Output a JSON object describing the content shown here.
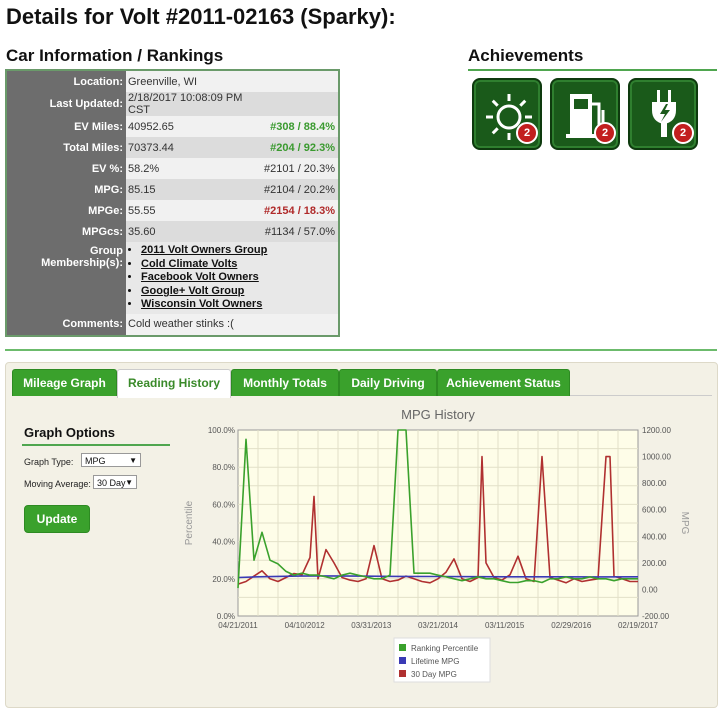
{
  "title": "Details for Volt #2011-02163 (Sparky):",
  "sections": {
    "car_info": "Car Information / Rankings",
    "achievements": "Achievements"
  },
  "info_rows": [
    {
      "label": "Location:",
      "value": "Greenville, WI",
      "rank": "",
      "rank_style": "norm"
    },
    {
      "label": "Last Updated:",
      "value": "2/18/2017 10:08:09 PM CST",
      "rank": "",
      "rank_style": "norm"
    },
    {
      "label": "EV Miles:",
      "value": "40952.65",
      "rank": "#308 / 88.4%",
      "rank_style": "good"
    },
    {
      "label": "Total Miles:",
      "value": "70373.44",
      "rank": "#204 / 92.3%",
      "rank_style": "good"
    },
    {
      "label": "EV %:",
      "value": "58.2%",
      "rank": "#2101 / 20.3%",
      "rank_style": "norm"
    },
    {
      "label": "MPG:",
      "value": "85.15",
      "rank": "#2104 / 20.2%",
      "rank_style": "norm"
    },
    {
      "label": "MPGe:",
      "value": "55.55",
      "rank": "#2154 / 18.3%",
      "rank_style": "bad"
    },
    {
      "label": "MPGcs:",
      "value": "35.60",
      "rank": "#1134 / 57.0%",
      "rank_style": "norm"
    }
  ],
  "groups_label": "Group Membership(s):",
  "groups": [
    "2011 Volt Owners Group",
    "Cold Climate Volts",
    "Facebook Volt Owners",
    "Google+ Volt Group",
    "Wisconsin Volt Owners"
  ],
  "comments_label": "Comments:",
  "comments": "Cold weather stinks :(",
  "achievements": [
    {
      "icon": "sun-icon",
      "count": "2"
    },
    {
      "icon": "gas-pump-icon",
      "count": "2"
    },
    {
      "icon": "electric-plug-icon",
      "count": "2"
    }
  ],
  "colors": {
    "accent": "#3aa12c",
    "ev_percentile": "#3aa12c",
    "lifetime_mpg": "#3a3ab5",
    "mpg_30day": "#b03030"
  },
  "tabs": [
    {
      "label": "Mileage Graph",
      "active": false
    },
    {
      "label": "Reading History",
      "active": true
    },
    {
      "label": "Monthly Totals",
      "active": false
    },
    {
      "label": "Daily Driving",
      "active": false
    },
    {
      "label": "Achievement Status",
      "active": false
    }
  ],
  "graph_options": {
    "title": "Graph Options",
    "type_label": "Graph Type:",
    "type_value": "MPG",
    "avg_label": "Moving Average:",
    "avg_value": "30 Day",
    "update_label": "Update"
  },
  "chart_data": {
    "type": "line",
    "title": "MPG History",
    "ylabel": "Percentile",
    "y2label": "MPG",
    "ylim": [
      0,
      100
    ],
    "y2lim": [
      -200,
      1200
    ],
    "x_ticks": [
      "04/21/2011",
      "04/10/2012",
      "03/31/2013",
      "03/21/2014",
      "03/11/2015",
      "02/29/2016",
      "02/19/2017"
    ],
    "y_ticks": [
      "0.0%",
      "20.0%",
      "40.0%",
      "60.0%",
      "80.0%",
      "100.0%"
    ],
    "y2_ticks": [
      "-200.00",
      "0.00",
      "200.00",
      "400.00",
      "600.00",
      "800.00",
      "1000.00",
      "1200.00"
    ],
    "legend": [
      "Ranking Percentile",
      "Lifetime MPG",
      "30 Day MPG"
    ],
    "legend_position": "bottom",
    "grid": true,
    "series": [
      {
        "name": "Ranking Percentile",
        "axis": "left",
        "x": [
          0,
          0.02,
          0.04,
          0.06,
          0.08,
          0.1,
          0.12,
          0.14,
          0.16,
          0.18,
          0.2,
          0.22,
          0.24,
          0.26,
          0.28,
          0.3,
          0.32,
          0.34,
          0.36,
          0.38,
          0.4,
          0.42,
          0.44,
          0.46,
          0.48,
          0.5,
          0.52,
          0.54,
          0.56,
          0.58,
          0.6,
          0.62,
          0.64,
          0.66,
          0.68,
          0.7,
          0.72,
          0.74,
          0.76,
          0.78,
          0.8,
          0.82,
          0.84,
          0.86,
          0.88,
          0.9,
          0.92,
          0.94,
          0.96,
          0.98,
          1.0
        ],
        "values": [
          15,
          95,
          30,
          45,
          30,
          28,
          24,
          22,
          23,
          22,
          22,
          21,
          20,
          22,
          23,
          22,
          21,
          20,
          20,
          22,
          100,
          100,
          23,
          23,
          23,
          22,
          21,
          20,
          19,
          20,
          21,
          20,
          20,
          19,
          18,
          18,
          19,
          19,
          18,
          20,
          20,
          21,
          20,
          20,
          21,
          20,
          20,
          19,
          20,
          20,
          20
        ]
      },
      {
        "name": "Lifetime MPG",
        "axis": "right",
        "x": [
          0,
          0.05,
          0.1,
          0.15,
          0.2,
          0.3,
          0.4,
          0.5,
          0.6,
          0.7,
          0.8,
          0.9,
          1.0
        ],
        "values": [
          90,
          95,
          98,
          100,
          102,
          100,
          98,
          97,
          96,
          95,
          95,
          94,
          95
        ]
      },
      {
        "name": "30 Day MPG",
        "axis": "right",
        "x": [
          0,
          0.02,
          0.04,
          0.06,
          0.08,
          0.1,
          0.12,
          0.14,
          0.16,
          0.18,
          0.19,
          0.2,
          0.22,
          0.24,
          0.26,
          0.28,
          0.3,
          0.32,
          0.34,
          0.36,
          0.38,
          0.4,
          0.42,
          0.44,
          0.46,
          0.48,
          0.5,
          0.52,
          0.54,
          0.56,
          0.58,
          0.6,
          0.61,
          0.62,
          0.64,
          0.66,
          0.68,
          0.7,
          0.72,
          0.74,
          0.76,
          0.78,
          0.8,
          0.82,
          0.84,
          0.86,
          0.88,
          0.9,
          0.92,
          0.93,
          0.94,
          0.96,
          0.98,
          1.0
        ],
        "values": [
          40,
          60,
          100,
          140,
          80,
          60,
          90,
          120,
          110,
          240,
          700,
          80,
          300,
          200,
          90,
          70,
          60,
          80,
          330,
          80,
          60,
          70,
          100,
          80,
          60,
          50,
          80,
          130,
          230,
          80,
          60,
          90,
          1000,
          200,
          90,
          70,
          110,
          250,
          80,
          60,
          1000,
          90,
          70,
          50,
          80,
          60,
          70,
          80,
          1000,
          1000,
          100,
          80,
          60,
          60
        ]
      }
    ]
  }
}
